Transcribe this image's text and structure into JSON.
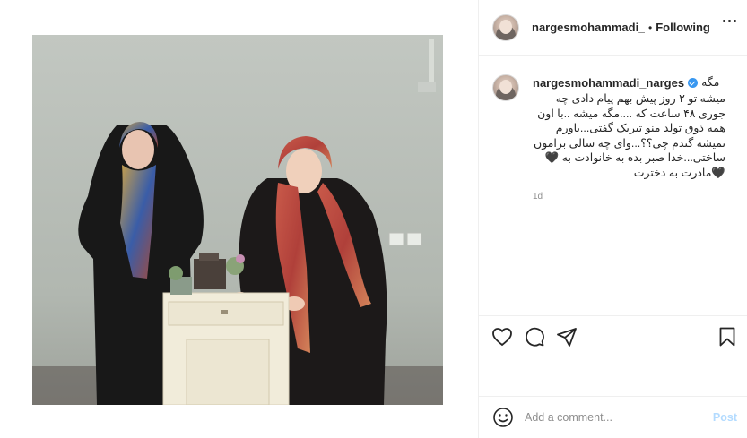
{
  "photo": {
    "icon": "post-photo",
    "description_colors": {
      "wall": "#b8bdb8",
      "floor": "#4a433f",
      "cabinet": "#f0ead8"
    }
  },
  "header": {
    "username": "nargesmohammadi_na",
    "separator": "•",
    "follow_label": "Following"
  },
  "caption": {
    "username": "nargesmohammadi_narges",
    "first_word": "مگه",
    "text": "میشه تو ۲ روز پیش بهم پیام دادی چه جوری ۴۸ ساعت که ....مگه میشه ..با اون همه ذوق تولد منو تبریک گفتی...باورم نمیشه گندم چی؟؟...وای چه سالی برامون ساختی...خدا صبر بده به خانوادت به 🖤🖤مادرت به دخترت",
    "time": "1d"
  },
  "actions": {
    "like_icon": "heart-icon",
    "comment_icon": "comment-icon",
    "share_icon": "share-icon",
    "save_icon": "bookmark-icon"
  },
  "comment_box": {
    "placeholder": "Add a comment...",
    "post_label": "Post",
    "post_color": "#b3dbff"
  }
}
